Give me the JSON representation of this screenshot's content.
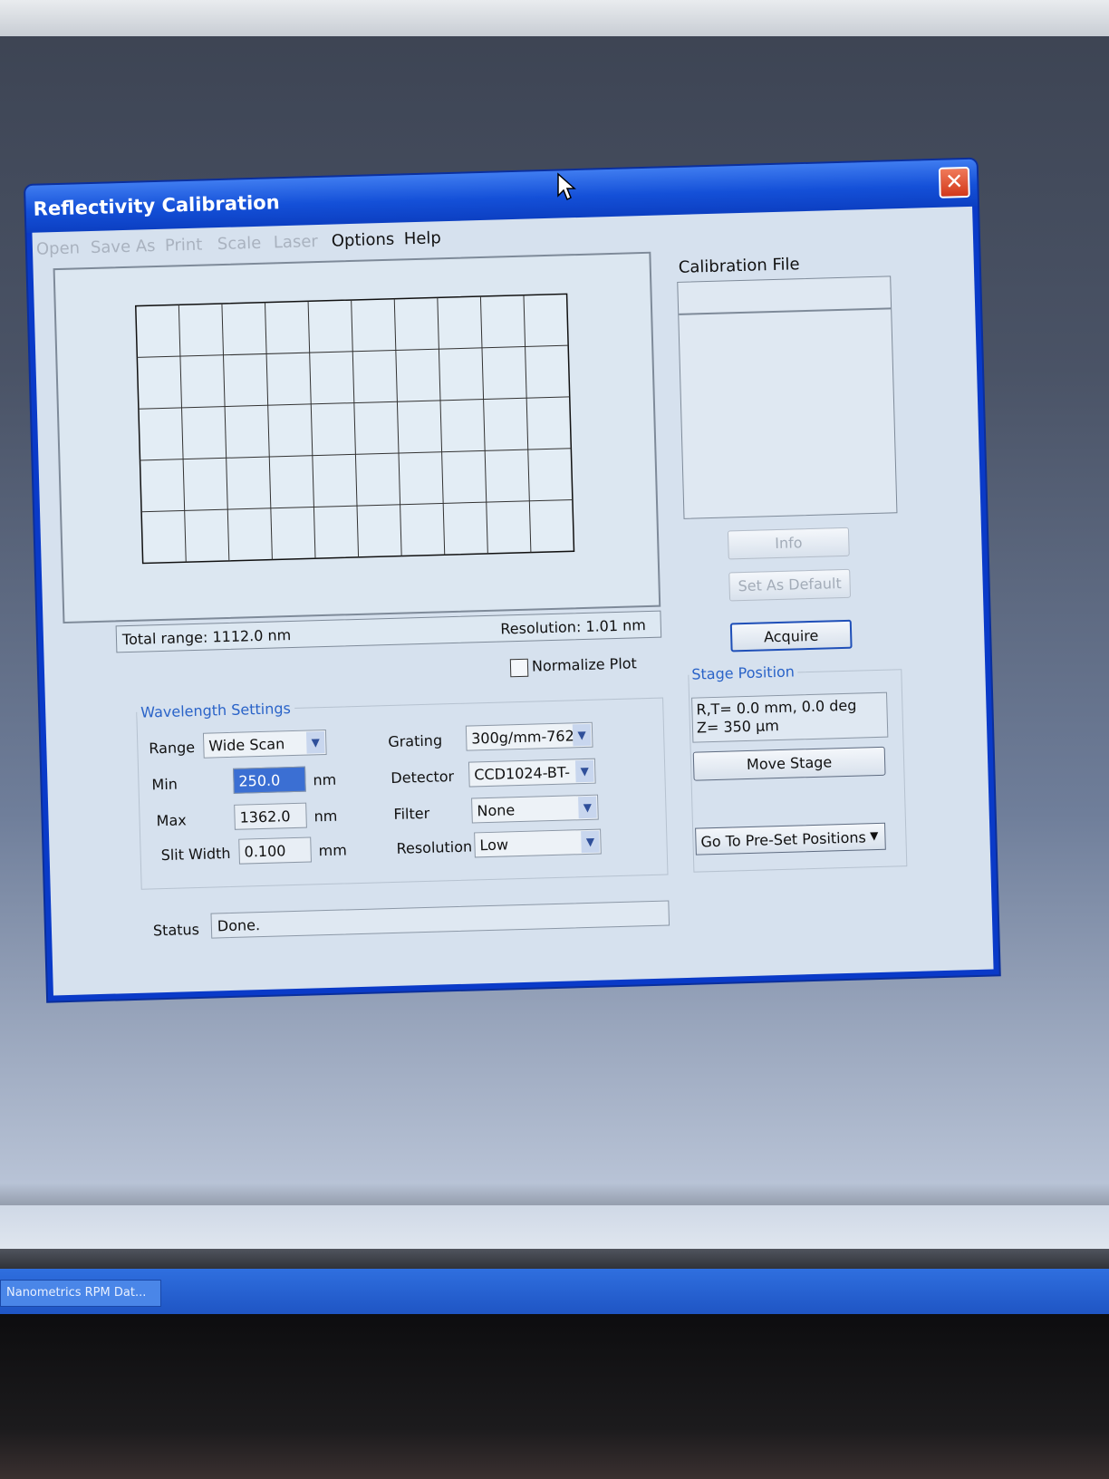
{
  "window": {
    "title": "Reflectivity Calibration"
  },
  "menu": [
    {
      "label": "Open",
      "enabled": false
    },
    {
      "label": "Save As",
      "enabled": false
    },
    {
      "label": "Print",
      "enabled": false
    },
    {
      "label": "Scale",
      "enabled": false
    },
    {
      "label": "Laser",
      "enabled": false
    },
    {
      "label": "Options",
      "enabled": true
    },
    {
      "label": "Help",
      "enabled": true
    }
  ],
  "plot": {
    "total_range": "Total range: 1112.0 nm",
    "resolution": "Resolution: 1.01 nm"
  },
  "normalize": {
    "label": "Normalize Plot",
    "checked": false
  },
  "wavelength": {
    "title": "Wavelength Settings",
    "range_label": "Range",
    "range_value": "Wide Scan",
    "min_label": "Min",
    "min_value": "250.0",
    "min_unit": "nm",
    "max_label": "Max",
    "max_value": "1362.0",
    "max_unit": "nm",
    "slit_label": "Slit Width",
    "slit_value": "0.100",
    "slit_unit": "mm",
    "grating_label": "Grating",
    "grating_value": "300g/mm-762",
    "detector_label": "Detector",
    "detector_value": "CCD1024-BT-",
    "filter_label": "Filter",
    "filter_value": "None",
    "resolution_label": "Resolution",
    "resolution_value": "Low"
  },
  "status": {
    "label": "Status",
    "value": "Done."
  },
  "calibration": {
    "title": "Calibration File",
    "info_button": "Info",
    "set_default_button": "Set As Default",
    "acquire_button": "Acquire"
  },
  "stage": {
    "title": "Stage Position",
    "line1": "R,T= 0.0 mm, 0.0 deg",
    "line2": "Z= 350 µm",
    "move_button": "Move Stage",
    "preset_button": "Go To Pre-Set Positions"
  },
  "taskbar": {
    "item": "Nanometrics RPM Dat..."
  }
}
